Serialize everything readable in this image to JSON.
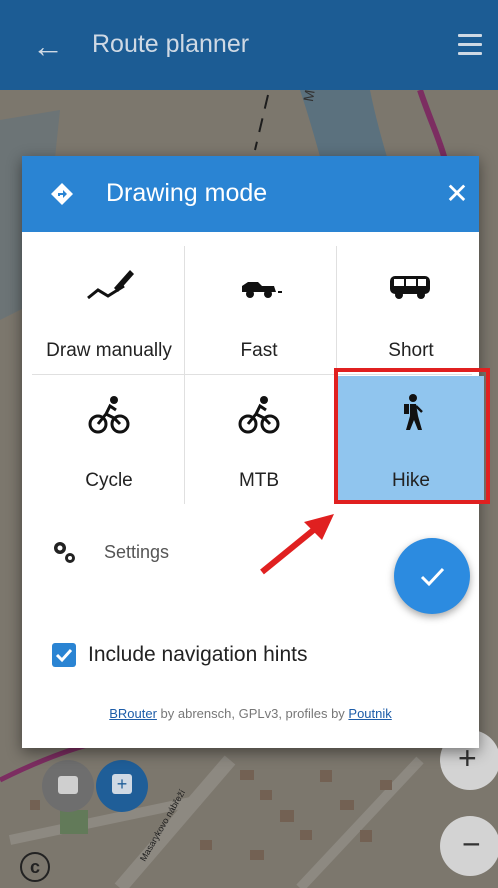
{
  "appbar": {
    "title": "Route planner"
  },
  "dialog": {
    "title": "Drawing mode",
    "modes": [
      {
        "label": "Draw manually",
        "icon": "draw-manually-icon"
      },
      {
        "label": "Fast",
        "icon": "car-icon"
      },
      {
        "label": "Short",
        "icon": "van-icon"
      },
      {
        "label": "Cycle",
        "icon": "bicycle-icon"
      },
      {
        "label": "MTB",
        "icon": "mountain-bike-icon"
      },
      {
        "label": "Hike",
        "icon": "hiker-icon"
      }
    ],
    "selected_mode": "Hike",
    "settings_label": "Settings",
    "include_hints_label": "Include navigation hints",
    "include_hints_checked": true,
    "credits": {
      "brouter_link": "BRouter",
      "middle_text": " by abrensch, GPLv3, profiles by ",
      "poutnik_link": "Poutnik"
    }
  },
  "map": {
    "labels": [
      "Morava",
      "Masarykovo nábřeží"
    ]
  },
  "colors": {
    "appbar": "#1c5c94",
    "dialog_header": "#2a84d3",
    "selected_cell": "#90c5ee",
    "highlight_border": "#e02020",
    "fab": "#2c8be0"
  }
}
